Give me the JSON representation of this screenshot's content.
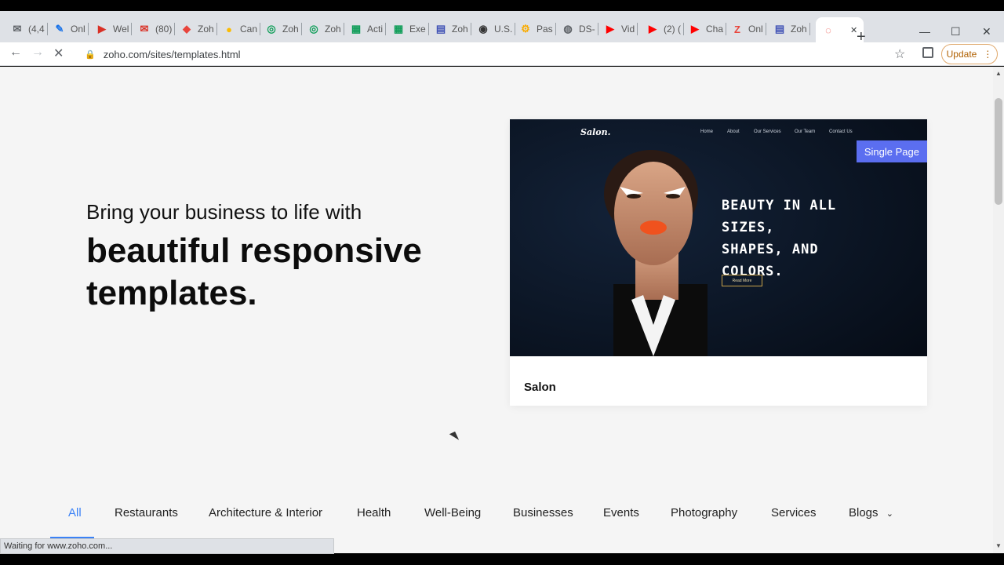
{
  "tabs": [
    {
      "label": "(4,4",
      "icon": "mail-icon",
      "color": "#5f6368"
    },
    {
      "label": "Onl",
      "icon": "edit-icon",
      "color": "#1a73e8"
    },
    {
      "label": "Wel",
      "icon": "slides-icon",
      "color": "#d93025"
    },
    {
      "label": "(80)",
      "icon": "megaphone-icon",
      "color": "#d93025"
    },
    {
      "label": "Zoh",
      "icon": "zoho-cube-icon",
      "color": "#e8453c"
    },
    {
      "label": "Can",
      "icon": "chrome-icon",
      "color": "#fbbc04"
    },
    {
      "label": "Zoh",
      "icon": "zoho-circle-icon",
      "color": "#0f9d58"
    },
    {
      "label": "Zoh",
      "icon": "zoho-circle-icon",
      "color": "#0f9d58"
    },
    {
      "label": "Acti",
      "icon": "sheet-icon",
      "color": "#0f9d58"
    },
    {
      "label": "Exe",
      "icon": "sheet-icon",
      "color": "#0f9d58"
    },
    {
      "label": "Zoh",
      "icon": "zoho-sites-icon",
      "color": "#3f51b5"
    },
    {
      "label": "U.S.",
      "icon": "seal-icon",
      "color": "#333333"
    },
    {
      "label": "Pas",
      "icon": "gear-icon",
      "color": "#f9ab00"
    },
    {
      "label": "DS-",
      "icon": "globe-icon",
      "color": "#5f6368"
    },
    {
      "label": "Vid",
      "icon": "youtube-icon",
      "color": "#ff0000"
    },
    {
      "label": "(2) (",
      "icon": "youtube-icon",
      "color": "#ff0000"
    },
    {
      "label": "Cha",
      "icon": "youtube-icon",
      "color": "#ff0000"
    },
    {
      "label": "Onl",
      "icon": "zoho-z-icon",
      "color": "#e8453c"
    },
    {
      "label": "Zoh",
      "icon": "zoho-sites-icon",
      "color": "#3f51b5"
    },
    {
      "label": "",
      "icon": "loading-icon",
      "color": "#e8453c"
    }
  ],
  "toolbar": {
    "url": "zoho.com/sites/templates.html",
    "update_label": "Update"
  },
  "hero": {
    "intro": "Bring your business to life with",
    "title": "beautiful responsive templates."
  },
  "card": {
    "badge": "Single Page",
    "name": "Salon",
    "preview": {
      "logo": "Salon.",
      "nav": [
        "Home",
        "About",
        "Our Services",
        "Our Team",
        "Contact Us"
      ],
      "headline": "BEAUTY IN ALL SIZES, SHAPES, AND COLORS.",
      "button": "Read More"
    }
  },
  "categories": [
    "All",
    "Restaurants",
    "Architecture & Interior",
    "Health",
    "Well-Being",
    "Businesses",
    "Events",
    "Photography",
    "Services",
    "Blogs"
  ],
  "status_text": "Waiting for www.zoho.com..."
}
